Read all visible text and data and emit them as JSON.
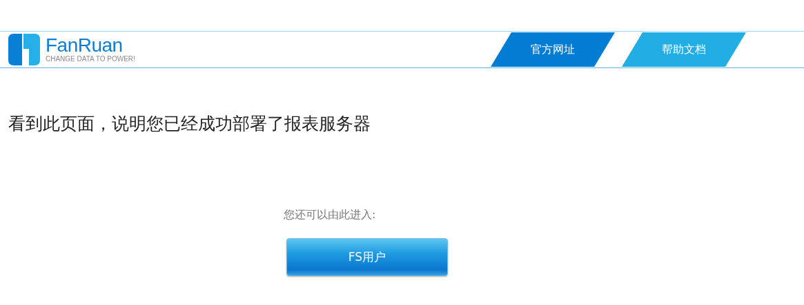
{
  "logo": {
    "name": "FanRuan",
    "tagline": "CHANGE DATA TO POWER!"
  },
  "nav_links": [
    {
      "label": "官方网址",
      "color": "#037dd4"
    },
    {
      "label": "帮助文档",
      "color": "#22ade4"
    }
  ],
  "heading": "看到此页面，说明您已经成功部署了报表服务器",
  "prompt": "您还可以由此进入:",
  "button": "FS用户"
}
